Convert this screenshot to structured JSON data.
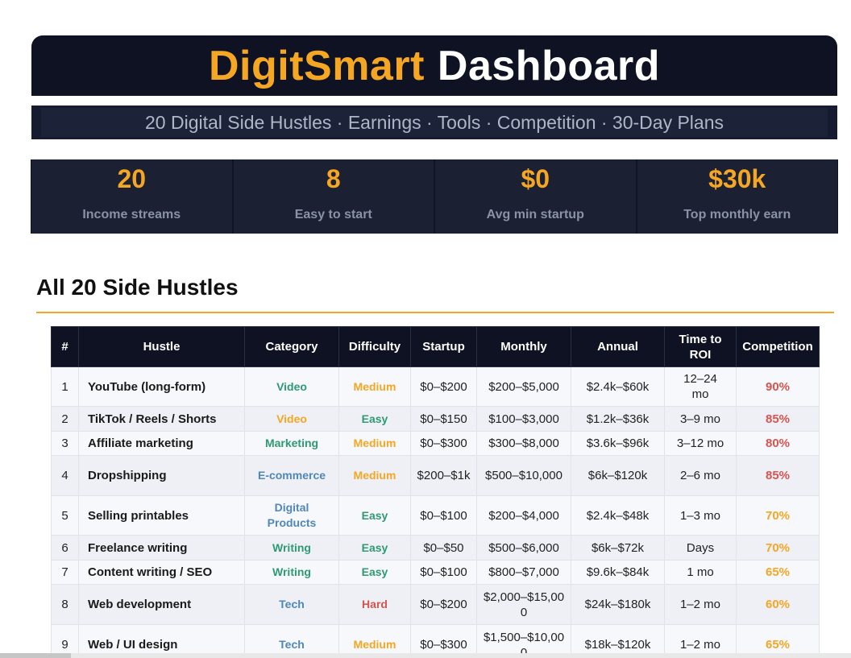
{
  "header": {
    "brand": "DigitSmart",
    "title_rest": "Dashboard"
  },
  "subtitle": "20 Digital Side Hustles · Earnings · Tools · Competition · 30-Day Plans",
  "stats": [
    {
      "value": "20",
      "label": "Income streams"
    },
    {
      "value": "8",
      "label": "Easy to start"
    },
    {
      "value": "$0",
      "label": "Avg min startup"
    },
    {
      "value": "$30k",
      "label": "Top monthly earn"
    }
  ],
  "section": {
    "title": "All 20 Side Hustles"
  },
  "table": {
    "headers": [
      "#",
      "Hustle",
      "Category",
      "Difficulty",
      "Startup",
      "Monthly",
      "Annual",
      "Time to ROI",
      "Competition"
    ],
    "rows": [
      {
        "num": "1",
        "name": "YouTube (long-form)",
        "category": "Video",
        "difficulty": "Medium",
        "startup": "$0–$200",
        "monthly": "$200–$5,000",
        "annual": "$2.4k–$60k",
        "roi": "12–24 mo",
        "competition": "90%"
      },
      {
        "num": "2",
        "name": "TikTok / Reels / Shorts",
        "category": "Video",
        "difficulty": "Easy",
        "startup": "$0–$150",
        "monthly": "$100–$3,000",
        "annual": "$1.2k–$36k",
        "roi": "3–9 mo",
        "competition": "85%"
      },
      {
        "num": "3",
        "name": "Affiliate marketing",
        "category": "Marketing",
        "difficulty": "Medium",
        "startup": "$0–$300",
        "monthly": "$300–$8,000",
        "annual": "$3.6k–$96k",
        "roi": "3–12 mo",
        "competition": "80%"
      },
      {
        "num": "4",
        "name": "Dropshipping",
        "category": "E-commerce",
        "difficulty": "Medium",
        "startup": "$200–$1k",
        "monthly": "$500–$10,000",
        "annual": "$6k–$120k",
        "roi": "2–6 mo",
        "competition": "85%"
      },
      {
        "num": "5",
        "name": "Selling printables",
        "category": "Digital Products",
        "difficulty": "Easy",
        "startup": "$0–$100",
        "monthly": "$200–$4,000",
        "annual": "$2.4k–$48k",
        "roi": "1–3 mo",
        "competition": "70%"
      },
      {
        "num": "6",
        "name": "Freelance writing",
        "category": "Writing",
        "difficulty": "Easy",
        "startup": "$0–$50",
        "monthly": "$500–$6,000",
        "annual": "$6k–$72k",
        "roi": "Days",
        "competition": "70%"
      },
      {
        "num": "7",
        "name": "Content writing / SEO",
        "category": "Writing",
        "difficulty": "Easy",
        "startup": "$0–$100",
        "monthly": "$800–$7,000",
        "annual": "$9.6k–$84k",
        "roi": "1 mo",
        "competition": "65%"
      },
      {
        "num": "8",
        "name": "Web development",
        "category": "Tech",
        "difficulty": "Hard",
        "startup": "$0–$200",
        "monthly": "$2,000–$15,000",
        "annual": "$24k–$180k",
        "roi": "1–2 mo",
        "competition": "60%"
      },
      {
        "num": "9",
        "name": "Web / UI design",
        "category": "Tech",
        "difficulty": "Medium",
        "startup": "$0–$300",
        "monthly": "$1,500–$10,000",
        "annual": "$18k–$120k",
        "roi": "1–2 mo",
        "competition": "65%"
      }
    ]
  },
  "colors": {
    "accent": "#f5a623",
    "dark_bg": "#0e1223",
    "green": "#2e9a72",
    "blue": "#4f87b8",
    "red": "#d9534f"
  }
}
